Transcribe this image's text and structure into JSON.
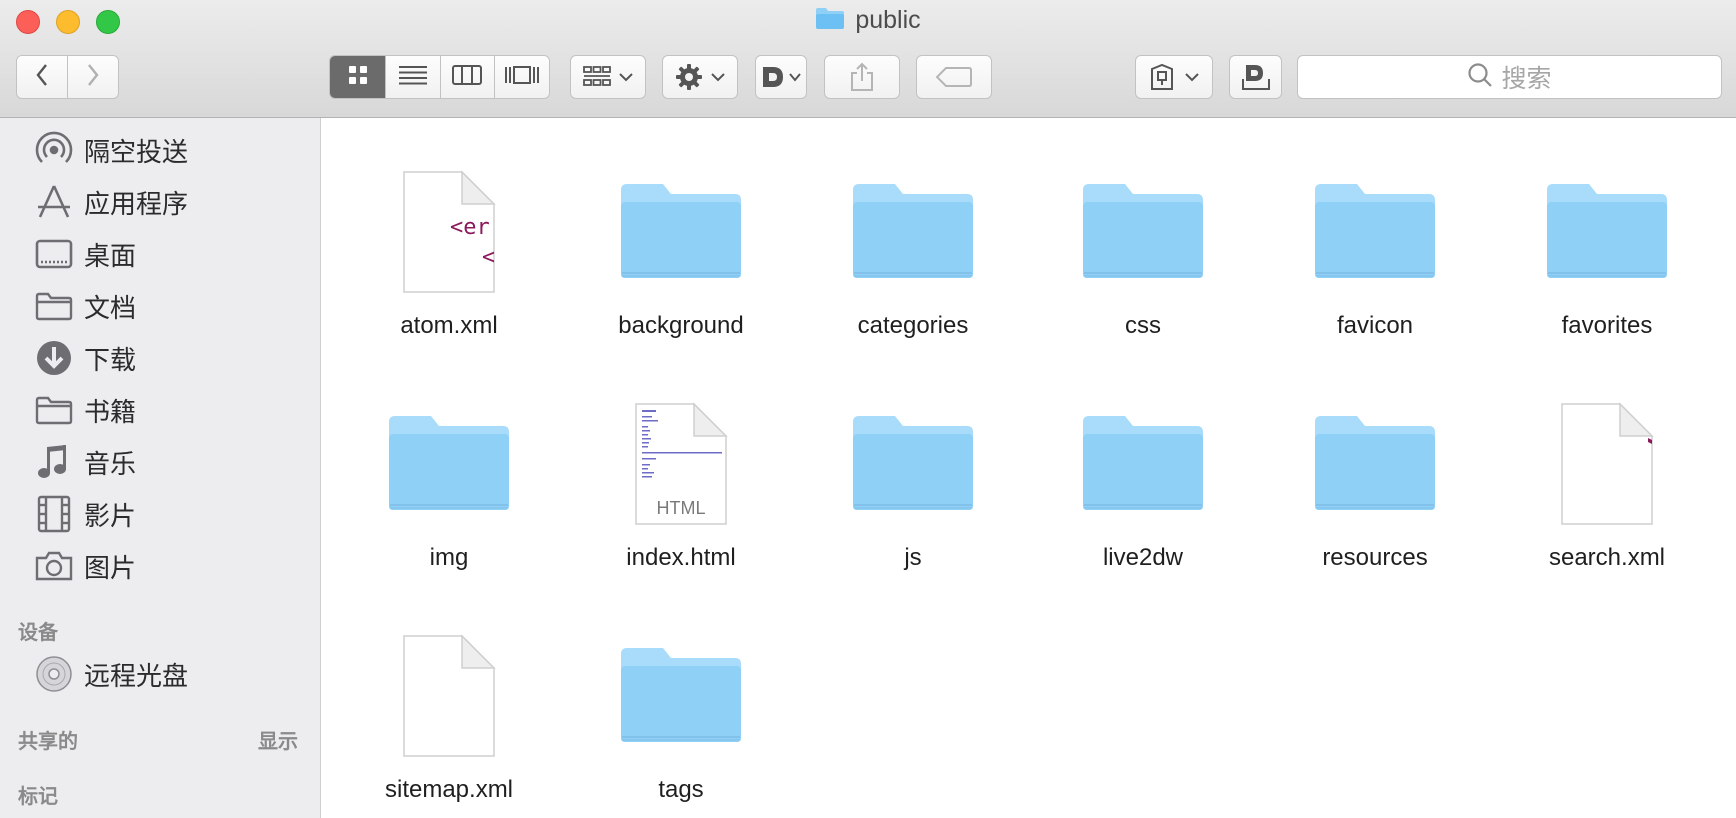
{
  "window": {
    "title": "public"
  },
  "toolbar": {
    "search_placeholder": "搜索",
    "html_badge": "HTML",
    "xml_snippet_1": "<er",
    "xml_snippet_2": "<"
  },
  "sidebar": {
    "favorites": [
      {
        "label": "隔空投送",
        "icon": "airdrop-icon"
      },
      {
        "label": "应用程序",
        "icon": "applications-icon"
      },
      {
        "label": "桌面",
        "icon": "desktop-icon"
      },
      {
        "label": "文档",
        "icon": "folder-icon"
      },
      {
        "label": "下载",
        "icon": "download-icon"
      },
      {
        "label": "书籍",
        "icon": "folder-icon"
      },
      {
        "label": "音乐",
        "icon": "music-icon"
      },
      {
        "label": "影片",
        "icon": "film-icon"
      },
      {
        "label": "图片",
        "icon": "camera-icon"
      }
    ],
    "devices_header": "设备",
    "devices": [
      {
        "label": "远程光盘",
        "icon": "disc-icon"
      }
    ],
    "shared_header": "共享的",
    "shared_show": "显示",
    "tags_header": "标记"
  },
  "files": [
    {
      "name": "atom.xml",
      "kind": "xml-preview"
    },
    {
      "name": "background",
      "kind": "folder"
    },
    {
      "name": "categories",
      "kind": "folder"
    },
    {
      "name": "css",
      "kind": "folder"
    },
    {
      "name": "favicon",
      "kind": "folder"
    },
    {
      "name": "favorites",
      "kind": "folder"
    },
    {
      "name": "img",
      "kind": "folder"
    },
    {
      "name": "index.html",
      "kind": "html"
    },
    {
      "name": "js",
      "kind": "folder"
    },
    {
      "name": "live2dw",
      "kind": "folder"
    },
    {
      "name": "resources",
      "kind": "folder"
    },
    {
      "name": "search.xml",
      "kind": "xml"
    },
    {
      "name": "sitemap.xml",
      "kind": "xml"
    },
    {
      "name": "tags",
      "kind": "folder"
    }
  ],
  "colors": {
    "folder": "#8fd0f7",
    "folder_tab": "#a9dcfa",
    "accent_active": "#6b6b6b"
  }
}
